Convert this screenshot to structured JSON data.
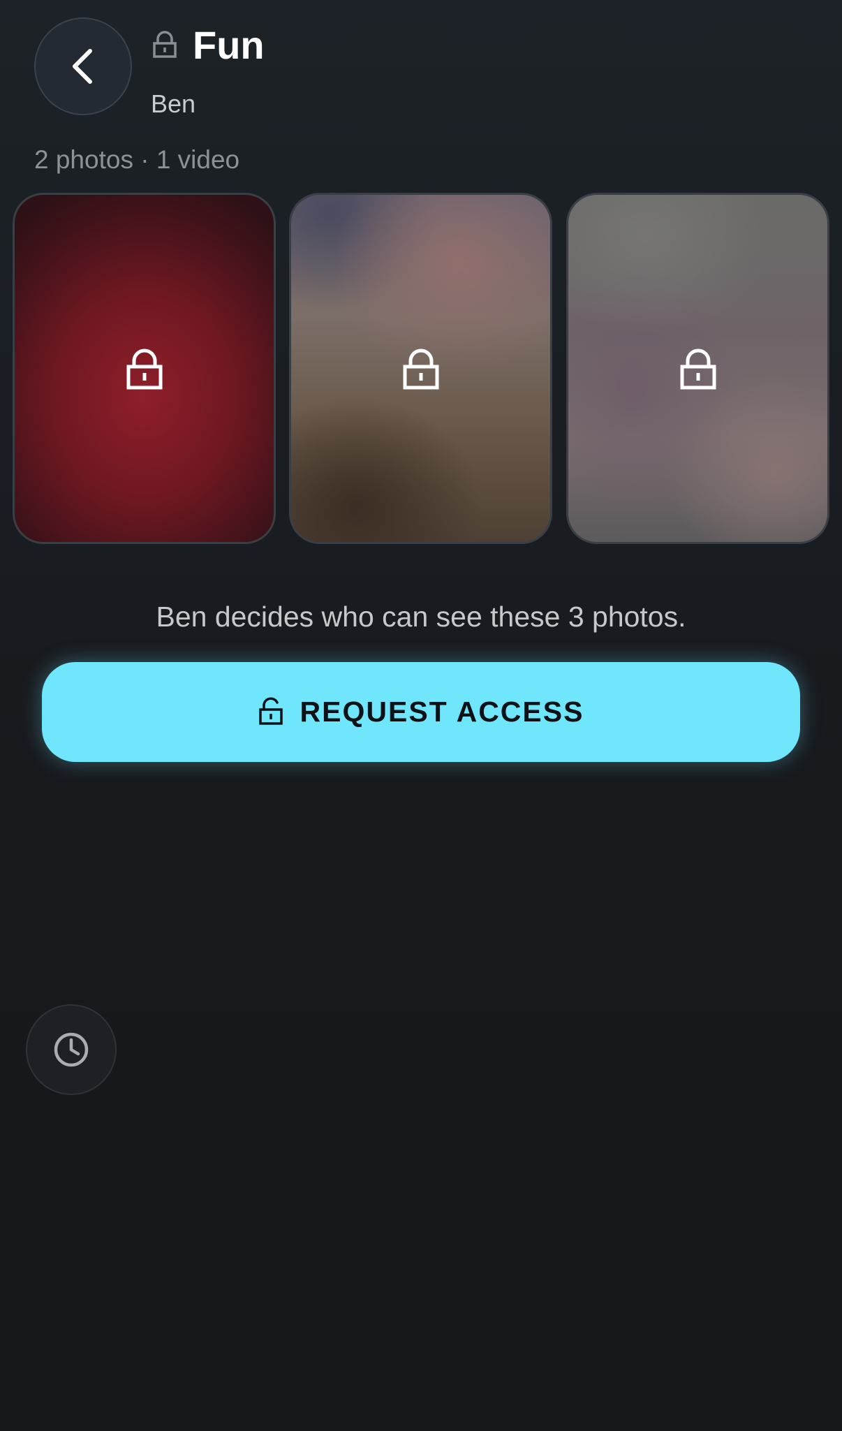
{
  "header": {
    "back_icon": "chevron-left-icon",
    "title_icon": "lock-icon",
    "title": "Fun",
    "owner": "Ben",
    "media_count": "2 photos · 1 video"
  },
  "gallery": {
    "tiles": [
      {
        "state": "locked",
        "icon": "lock-icon",
        "tint": "#8e1e2a"
      },
      {
        "state": "locked",
        "icon": "lock-icon",
        "tint": "#7c6e68"
      },
      {
        "state": "locked",
        "icon": "lock-icon",
        "tint": "#6e6468"
      }
    ]
  },
  "access": {
    "message": "Ben decides who can see these 3 photos.",
    "button_icon": "unlock-icon",
    "button_label": "REQUEST ACCESS",
    "accent_color": "#6fe6fc"
  },
  "footer": {
    "history_icon": "clock-icon"
  }
}
